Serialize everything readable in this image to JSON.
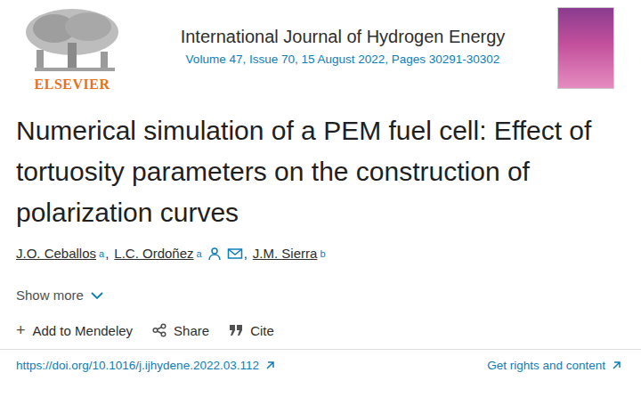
{
  "publisher": {
    "name": "ELSEVIER"
  },
  "journal": {
    "title": "International Journal of Hydrogen Energy",
    "issue": "Volume 47, Issue 70, 15 August 2022, Pages 30291-30302"
  },
  "article": {
    "title": "Numerical simulation of a PEM fuel cell: Effect of tortuosity parameters on the construction of polarization curves",
    "authors": [
      {
        "name": "J.O. Ceballos",
        "affiliation": "a",
        "corresponding": false,
        "separator": ","
      },
      {
        "name": "L.C. Ordoñez",
        "affiliation": "a",
        "corresponding": true,
        "separator": ","
      },
      {
        "name": "J.M. Sierra",
        "affiliation": "b",
        "corresponding": false,
        "separator": ""
      }
    ]
  },
  "show_more": "Show more",
  "actions": [
    {
      "label": "Add to Mendeley",
      "glyph": "+",
      "kind": "mendeley"
    },
    {
      "label": "Share",
      "glyph": "",
      "kind": "share"
    },
    {
      "label": "Cite",
      "glyph": "",
      "kind": "cite"
    }
  ],
  "doi": "https://doi.org/10.1016/j.ijhydene.2022.03.112",
  "rights": "Get rights and content"
}
